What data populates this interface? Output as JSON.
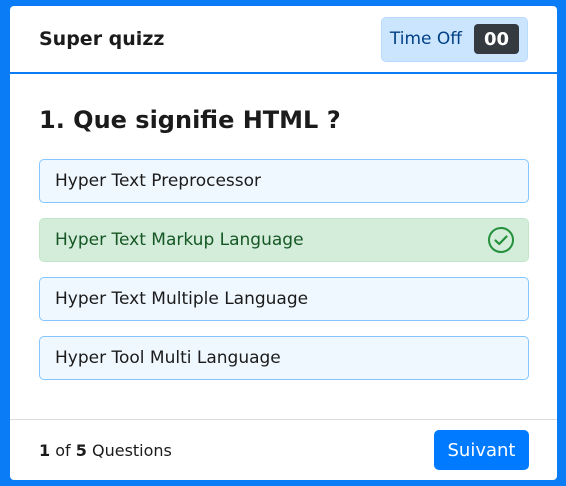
{
  "header": {
    "title": "Super quizz",
    "timer_label": "Time Off",
    "timer_value": "00"
  },
  "question": {
    "text": "1. Que signifie HTML ?"
  },
  "options": [
    {
      "label": "Hyper Text Preprocessor",
      "state": "default"
    },
    {
      "label": "Hyper Text Markup Language",
      "state": "correct",
      "icon": "check-circle-icon"
    },
    {
      "label": "Hyper Text Multiple Language",
      "state": "default"
    },
    {
      "label": "Hyper Tool Multi Language",
      "state": "default"
    }
  ],
  "footer": {
    "current": "1",
    "of": "of",
    "total": "5",
    "questions_label": "Questions",
    "next_label": "Suivant"
  },
  "colors": {
    "accent": "#0a7cf5",
    "correct_bg": "#d4edda",
    "correct_text": "#155724",
    "option_bg": "#f0f8ff",
    "option_border": "#84c5fe",
    "timer_bg": "#cce5ff",
    "timer_value_bg": "#343a40",
    "button_bg": "#007bff"
  }
}
